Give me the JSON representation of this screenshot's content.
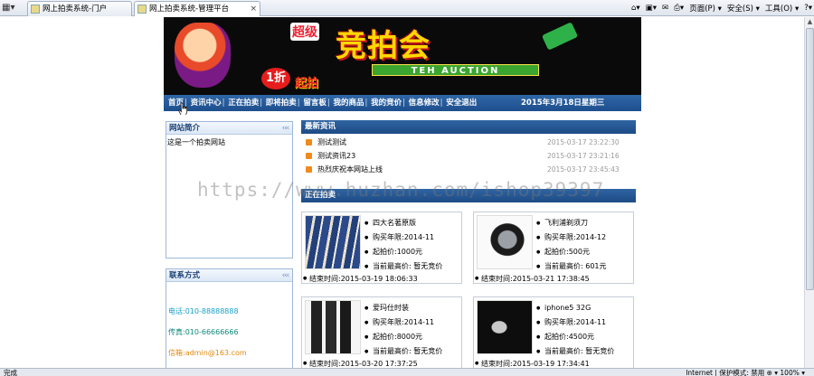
{
  "browser": {
    "tabs": [
      {
        "label": "网上拍卖系统-门户"
      },
      {
        "label": "网上拍卖系统-管理平台"
      }
    ],
    "commands": {
      "page": "页面(P) ▾",
      "safety": "安全(S) ▾",
      "tools": "工具(O) ▾",
      "help": "?▾"
    },
    "status": {
      "left": "完成",
      "right": "Internet | 保护模式: 禁用     ⊕ ▾  100% ▾"
    }
  },
  "banner": {
    "super": "超级",
    "main": "竞拍会",
    "english": "TEH AUCTION",
    "zhe": "1折",
    "qipai": "起拍"
  },
  "nav": {
    "items": [
      "首页",
      "资讯中心",
      "正在拍卖",
      "即将拍卖",
      "留言板",
      "我的商品",
      "我的竞价",
      "信息修改",
      "安全退出"
    ],
    "date": "2015年3月18日星期三"
  },
  "sidebar": {
    "intro_title": "网站简介",
    "intro_text": "这是一个拍卖网站",
    "contact_title": "联系方式",
    "more_glyph": "‹‹‹",
    "contacts": [
      {
        "text": "电话:010-88888888",
        "color": "#18a0c8"
      },
      {
        "text": "传真:010-66666666",
        "color": "#0f8a7a"
      },
      {
        "text": "信箱:admin@163.com",
        "color": "#e08a10"
      }
    ]
  },
  "news": {
    "title": "最新资讯",
    "more_glyph": "‹‹‹",
    "items": [
      {
        "title": "测试测试",
        "time": "2015-03-17 23:22:30"
      },
      {
        "title": "测试资讯23",
        "time": "2015-03-17 23:21:16"
      },
      {
        "title": "热烈庆祝本网站上线",
        "time": "2015-03-17 23:45:43"
      }
    ]
  },
  "auction": {
    "title": "正在拍卖",
    "cards": [
      {
        "name": "四大名著原版",
        "buy_year": "购买年限:2014-11",
        "start_price": "起拍价:1000元",
        "current": "当前最高价: 暂无竞价",
        "end": "结束时间:2015-03-19  18:06:33",
        "img": "img-books"
      },
      {
        "name": "飞利浦剃须刀",
        "buy_year": "购买年限:2014-12",
        "start_price": "起拍价:500元",
        "current": "当前最高价: 601元",
        "end": "结束时间:2015-03-21  17:38:45",
        "img": "img-shaver"
      },
      {
        "name": "爱玛仕时装",
        "buy_year": "购买年限:2014-11",
        "start_price": "起拍价:8000元",
        "current": "当前最高价: 暂无竞价",
        "end": "结束时间:2015-03-20  17:37:25",
        "img": "img-suits"
      },
      {
        "name": "iphone5 32G",
        "buy_year": "购买年限:2014-11",
        "start_price": "起拍价:4500元",
        "current": "当前最高价: 暂无竞价",
        "end": "结束时间:2015-03-19  17:34:41",
        "img": "img-phone"
      }
    ]
  },
  "watermark": "https://www.huzhan.com/ishop39397"
}
